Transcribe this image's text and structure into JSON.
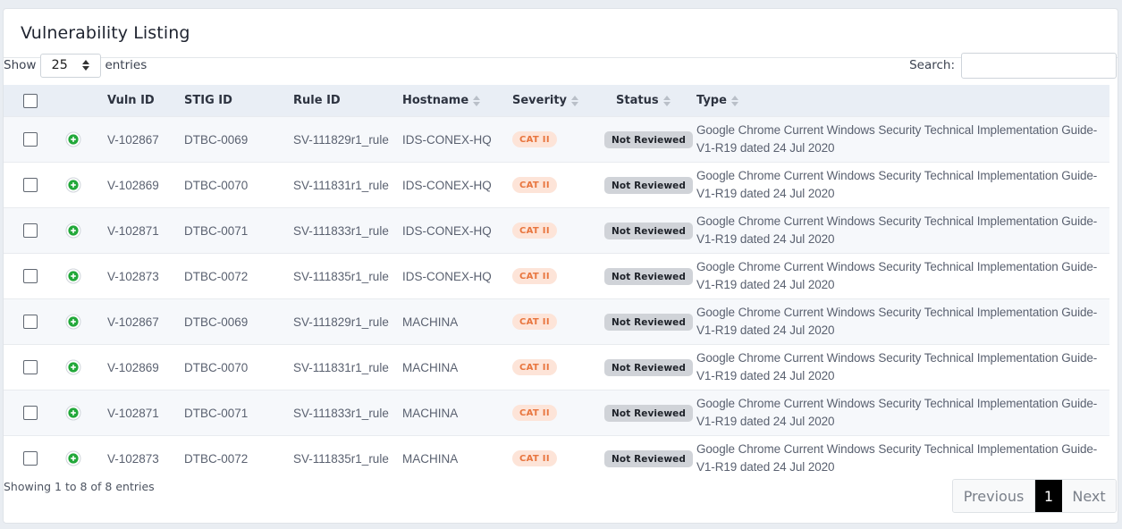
{
  "page": {
    "title": "Vulnerability Listing"
  },
  "controls": {
    "show_label": "Show",
    "entries_value": "25",
    "entries_label": "entries",
    "search_label": "Search:",
    "search_value": ""
  },
  "table": {
    "columns": [
      "",
      "",
      "Vuln ID",
      "STIG ID",
      "Rule ID",
      "Hostname",
      "Severity",
      "Status",
      "Type"
    ],
    "rows": [
      {
        "vuln_id": "V-102867",
        "stig_id": "DTBC-0069",
        "rule_id": "SV-111829r1_rule",
        "hostname": "IDS-CONEX-HQ",
        "severity": "CAT II",
        "status": "Not Reviewed",
        "type": "Google Chrome Current Windows Security Technical Implementation Guide-V1-R19 dated 24 Jul 2020"
      },
      {
        "vuln_id": "V-102869",
        "stig_id": "DTBC-0070",
        "rule_id": "SV-111831r1_rule",
        "hostname": "IDS-CONEX-HQ",
        "severity": "CAT II",
        "status": "Not Reviewed",
        "type": "Google Chrome Current Windows Security Technical Implementation Guide-V1-R19 dated 24 Jul 2020"
      },
      {
        "vuln_id": "V-102871",
        "stig_id": "DTBC-0071",
        "rule_id": "SV-111833r1_rule",
        "hostname": "IDS-CONEX-HQ",
        "severity": "CAT II",
        "status": "Not Reviewed",
        "type": "Google Chrome Current Windows Security Technical Implementation Guide-V1-R19 dated 24 Jul 2020"
      },
      {
        "vuln_id": "V-102873",
        "stig_id": "DTBC-0072",
        "rule_id": "SV-111835r1_rule",
        "hostname": "IDS-CONEX-HQ",
        "severity": "CAT II",
        "status": "Not Reviewed",
        "type": "Google Chrome Current Windows Security Technical Implementation Guide-V1-R19 dated 24 Jul 2020"
      },
      {
        "vuln_id": "V-102867",
        "stig_id": "DTBC-0069",
        "rule_id": "SV-111829r1_rule",
        "hostname": "MACHINA",
        "severity": "CAT II",
        "status": "Not Reviewed",
        "type": "Google Chrome Current Windows Security Technical Implementation Guide-V1-R19 dated 24 Jul 2020"
      },
      {
        "vuln_id": "V-102869",
        "stig_id": "DTBC-0070",
        "rule_id": "SV-111831r1_rule",
        "hostname": "MACHINA",
        "severity": "CAT II",
        "status": "Not Reviewed",
        "type": "Google Chrome Current Windows Security Technical Implementation Guide-V1-R19 dated 24 Jul 2020"
      },
      {
        "vuln_id": "V-102871",
        "stig_id": "DTBC-0071",
        "rule_id": "SV-111833r1_rule",
        "hostname": "MACHINA",
        "severity": "CAT II",
        "status": "Not Reviewed",
        "type": "Google Chrome Current Windows Security Technical Implementation Guide-V1-R19 dated 24 Jul 2020"
      },
      {
        "vuln_id": "V-102873",
        "stig_id": "DTBC-0072",
        "rule_id": "SV-111835r1_rule",
        "hostname": "MACHINA",
        "severity": "CAT II",
        "status": "Not Reviewed",
        "type": "Google Chrome Current Windows Security Technical Implementation Guide-V1-R19 dated 24 Jul 2020"
      }
    ]
  },
  "footer": {
    "info": "Showing 1 to 8 of 8 entries",
    "previous_label": "Previous",
    "current_page": "1",
    "next_label": "Next"
  },
  "icons": {
    "expand": "plus-circle-icon",
    "sort": "sort-arrows-icon",
    "select_caret": "select-caret-icon"
  },
  "colors": {
    "expand_icon": "#22a83a",
    "severity_bg": "#fde4d8",
    "severity_text": "#e8753e",
    "status_bg": "#d0d3d8",
    "header_bg": "#e9eef5",
    "pager_active": "#000000"
  }
}
